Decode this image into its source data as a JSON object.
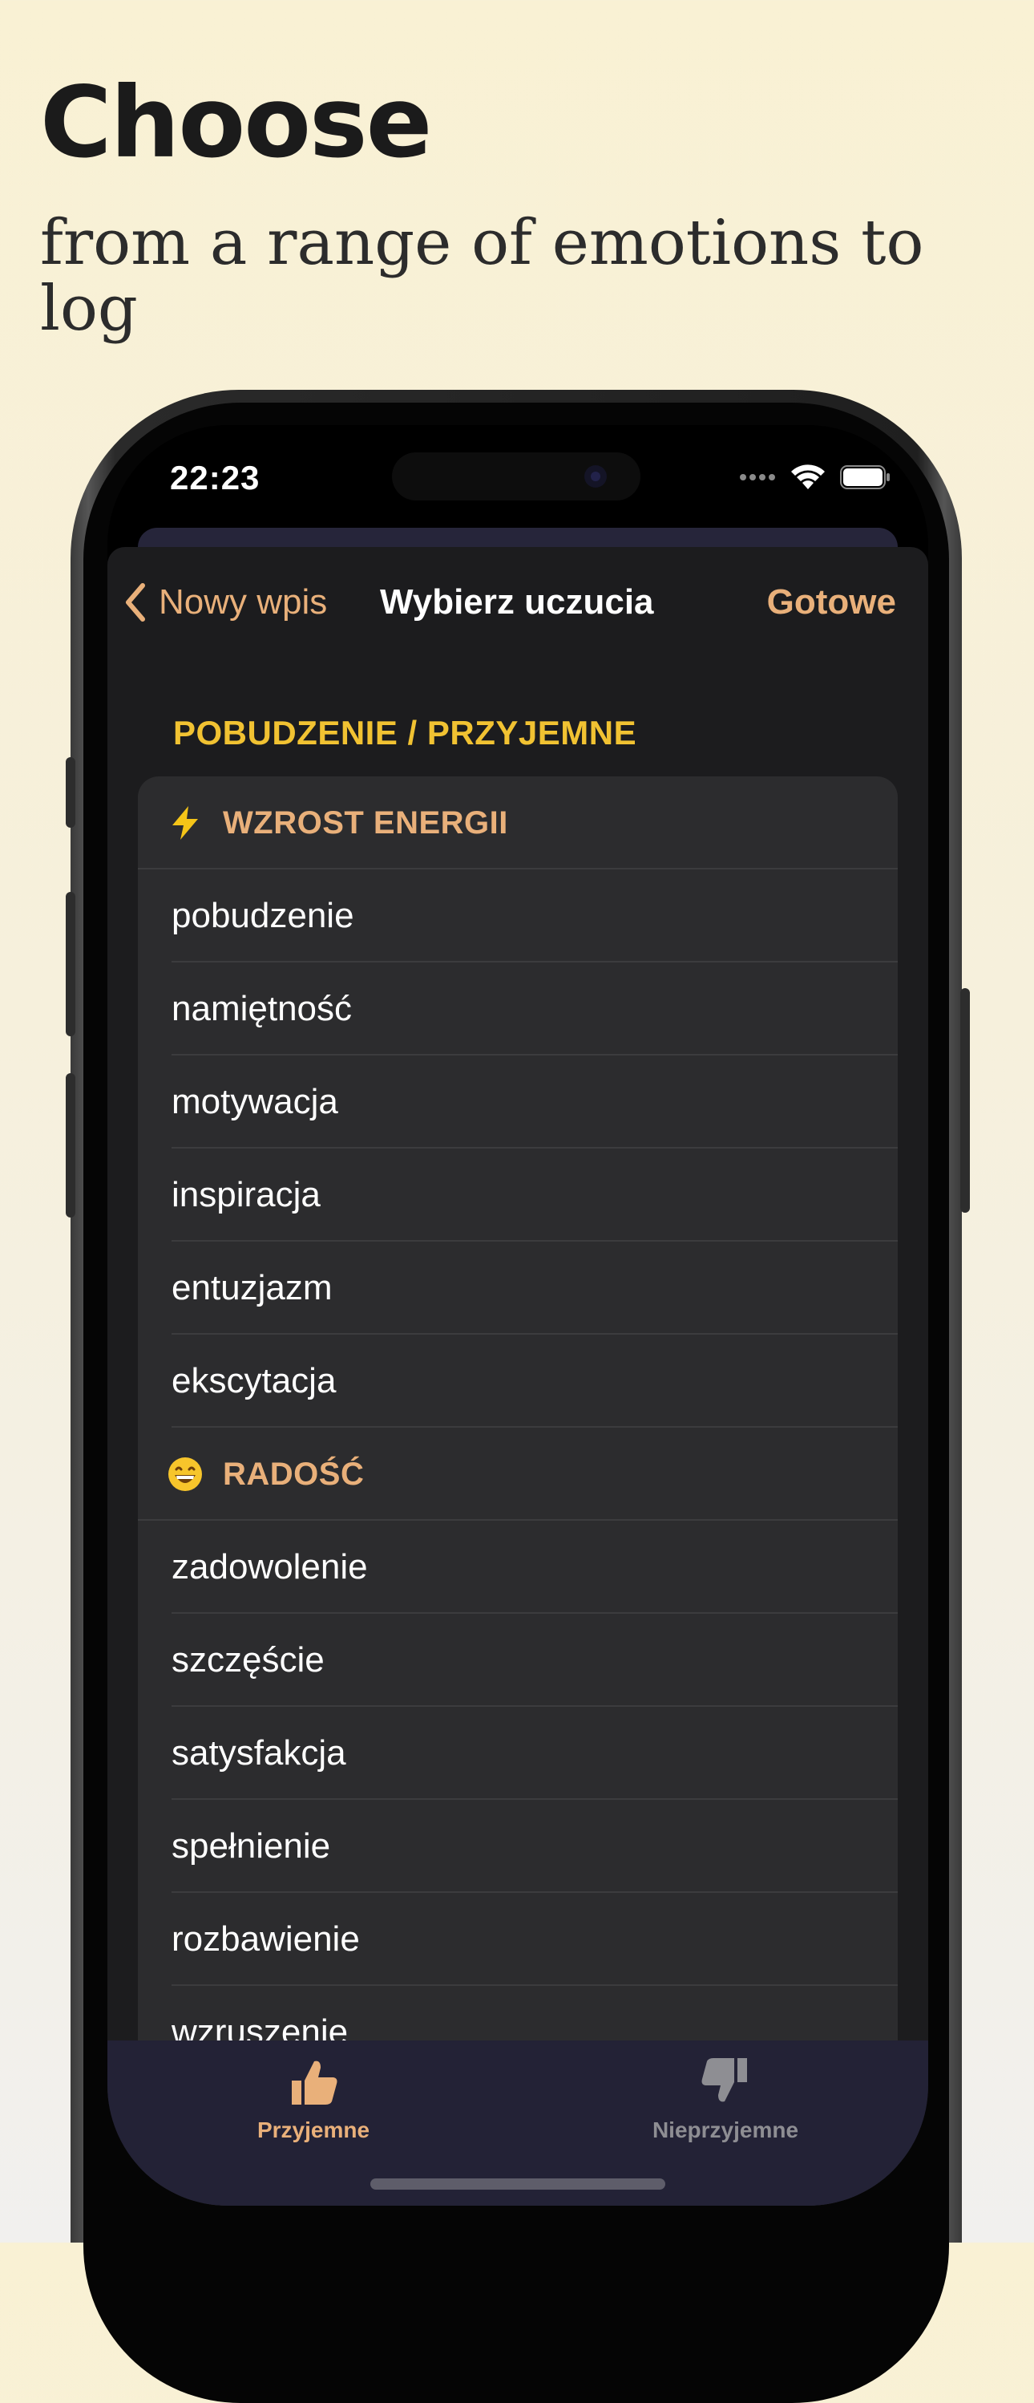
{
  "headline": "Choose",
  "subline": "from a range of emotions to log",
  "status": {
    "time": "22:23"
  },
  "nav": {
    "back_label": "Nowy wpis",
    "title": "Wybierz uczucia",
    "done_label": "Gotowe"
  },
  "section": {
    "header": "POBUDZENIE / PRZYJEMNE"
  },
  "list": [
    {
      "type": "group",
      "icon": "lightning-icon",
      "label": "WZROST ENERGII"
    },
    {
      "type": "item",
      "label": "pobudzenie"
    },
    {
      "type": "item",
      "label": "namiętność"
    },
    {
      "type": "item",
      "label": "motywacja"
    },
    {
      "type": "item",
      "label": "inspiracja"
    },
    {
      "type": "item",
      "label": "entuzjazm"
    },
    {
      "type": "item",
      "label": "ekscytacja"
    },
    {
      "type": "group",
      "icon": "grinning-face-icon",
      "label": "RADOŚĆ"
    },
    {
      "type": "item",
      "label": "zadowolenie"
    },
    {
      "type": "item",
      "label": "szczęście"
    },
    {
      "type": "item",
      "label": "satysfakcja"
    },
    {
      "type": "item",
      "label": "spełnienie"
    },
    {
      "type": "item",
      "label": "rozbawienie"
    },
    {
      "type": "item",
      "label": "wzruszenie"
    }
  ],
  "tabbar": {
    "pleasant_label": "Przyjemne",
    "unpleasant_label": "Nieprzyjemne"
  },
  "colors": {
    "accent": "#e9b07a",
    "section_header": "#f1c232",
    "sheet_bg": "#1c1c1e",
    "card_bg": "#2c2c2e",
    "tabbar_bg": "#232236",
    "tab_inactive": "#8e8e93"
  }
}
